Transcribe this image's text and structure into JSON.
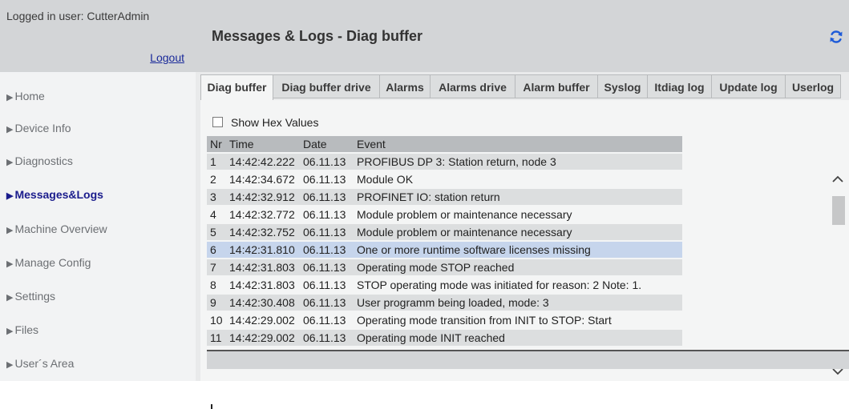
{
  "user": {
    "logged_in_text": "Logged in user: CutterAdmin",
    "logout_label": "Logout"
  },
  "sidebar": {
    "items": [
      {
        "label": "Home"
      },
      {
        "label": "Device Info"
      },
      {
        "label": "Diagnostics"
      },
      {
        "label": "Messages&Logs",
        "active": true
      },
      {
        "label": "Machine Overview"
      },
      {
        "label": "Manage Config"
      },
      {
        "label": "Settings"
      },
      {
        "label": "Files"
      },
      {
        "label": "User´s Area"
      }
    ]
  },
  "header": {
    "title": "Messages & Logs - Diag buffer",
    "refresh_icon": "refresh-icon"
  },
  "tabs": [
    {
      "label": "Diag buffer",
      "active": true
    },
    {
      "label": "Diag buffer drive"
    },
    {
      "label": "Alarms"
    },
    {
      "label": "Alarms drive"
    },
    {
      "label": "Alarm buffer"
    },
    {
      "label": "Syslog"
    },
    {
      "label": "Itdiag log"
    },
    {
      "label": "Update log"
    },
    {
      "label": "Userlog"
    }
  ],
  "options": {
    "show_hex_label": "Show Hex Values",
    "show_hex_checked": false
  },
  "table": {
    "columns": [
      "Nr",
      "Time",
      "Date",
      "Event"
    ],
    "rows": [
      {
        "nr": "1",
        "time": "14:42:42.222",
        "date": "06.11.13",
        "event": "PROFIBUS DP 3: Station return, node 3"
      },
      {
        "nr": "2",
        "time": "14:42:34.672",
        "date": "06.11.13",
        "event": "Module OK"
      },
      {
        "nr": "3",
        "time": "14:42:32.912",
        "date": "06.11.13",
        "event": "PROFINET IO: station return"
      },
      {
        "nr": "4",
        "time": "14:42:32.772",
        "date": "06.11.13",
        "event": "Module problem or maintenance necessary"
      },
      {
        "nr": "5",
        "time": "14:42:32.752",
        "date": "06.11.13",
        "event": "Module problem or maintenance necessary"
      },
      {
        "nr": "6",
        "time": "14:42:31.810",
        "date": "06.11.13",
        "event": "One or more runtime software licenses missing",
        "selected": true
      },
      {
        "nr": "7",
        "time": "14:42:31.803",
        "date": "06.11.13",
        "event": "Operating mode STOP reached"
      },
      {
        "nr": "8",
        "time": "14:42:31.803",
        "date": "06.11.13",
        "event": "STOP operating mode was initiated for reason: 2 Note: 1."
      },
      {
        "nr": "9",
        "time": "14:42:30.408",
        "date": "06.11.13",
        "event": "User programm being loaded, mode: 3"
      },
      {
        "nr": "10",
        "time": "14:42:29.002",
        "date": "06.11.13",
        "event": "Operating mode transition from INIT to STOP: Start"
      },
      {
        "nr": "11",
        "time": "14:42:29.002",
        "date": "06.11.13",
        "event": "Operating mode INIT reached"
      }
    ]
  },
  "colors": {
    "accent_blue": "#1a1c8c",
    "refresh_blue": "#1e5bd8",
    "selected_row": "#c6d5ec"
  }
}
